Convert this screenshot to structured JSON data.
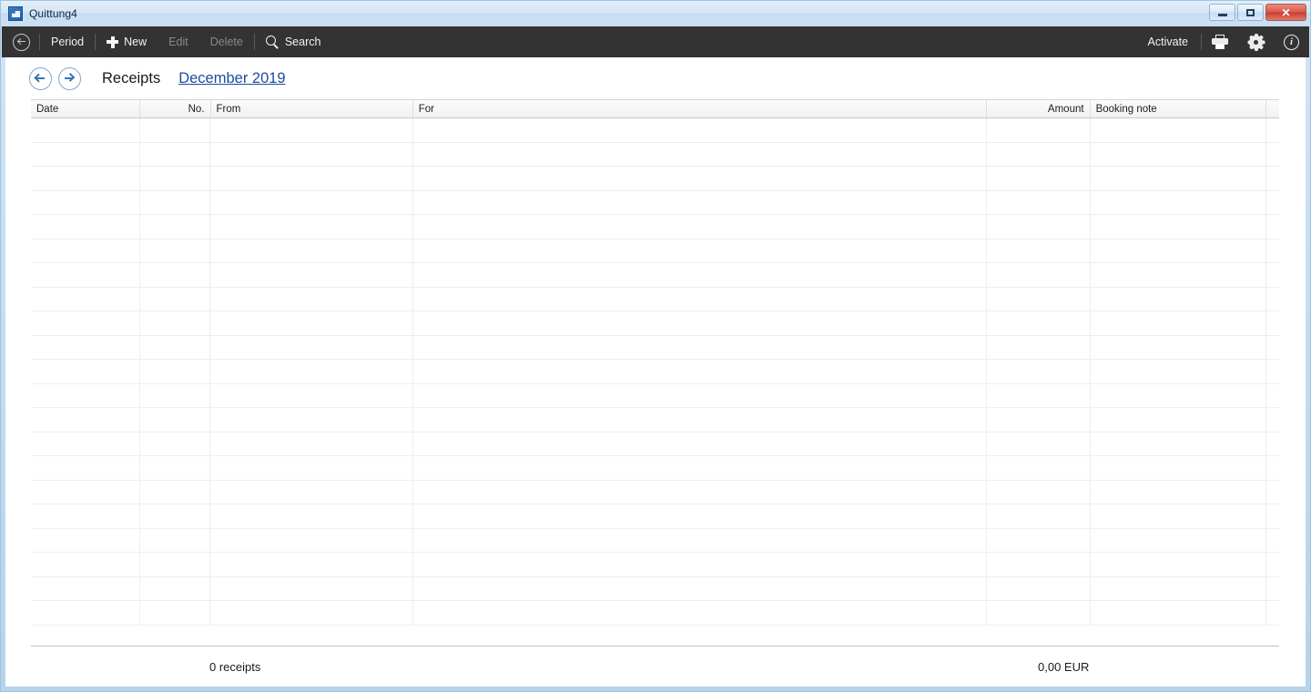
{
  "window": {
    "title": "Quittung4",
    "app_icon": "app-icon",
    "controls": {
      "minimize": "minimize-button",
      "maximize": "maximize-button",
      "close_label": "✕"
    }
  },
  "toolbar": {
    "back_icon": "circle-back-arrow-icon",
    "period_label": "Period",
    "new_label": "New",
    "new_icon": "plus-icon",
    "edit_label": "Edit",
    "delete_label": "Delete",
    "search_label": "Search",
    "search_icon": "magnifier-icon",
    "activate_label": "Activate",
    "print_icon": "printer-icon",
    "settings_icon": "gear-icon",
    "info_icon": "info-circle-icon",
    "info_glyph": "i",
    "background_color": "#333333",
    "disabled_color": "#8a8a8a"
  },
  "page": {
    "back_nav": "nav-back-arrow",
    "forward_nav": "nav-forward-arrow",
    "title": "Receipts",
    "period_link": "December 2019",
    "link_color": "#1b4c9e"
  },
  "grid": {
    "columns": [
      {
        "label": "Date",
        "align": "left"
      },
      {
        "label": "No.",
        "align": "right"
      },
      {
        "label": "From",
        "align": "left"
      },
      {
        "label": "For",
        "align": "left"
      },
      {
        "label": "Amount",
        "align": "right"
      },
      {
        "label": "Booking note",
        "align": "left"
      },
      {
        "label": "",
        "align": "left"
      }
    ],
    "rows": [],
    "empty_row_count": 21
  },
  "footer": {
    "count_label": "0 receipts",
    "total_label": "0,00 EUR"
  }
}
